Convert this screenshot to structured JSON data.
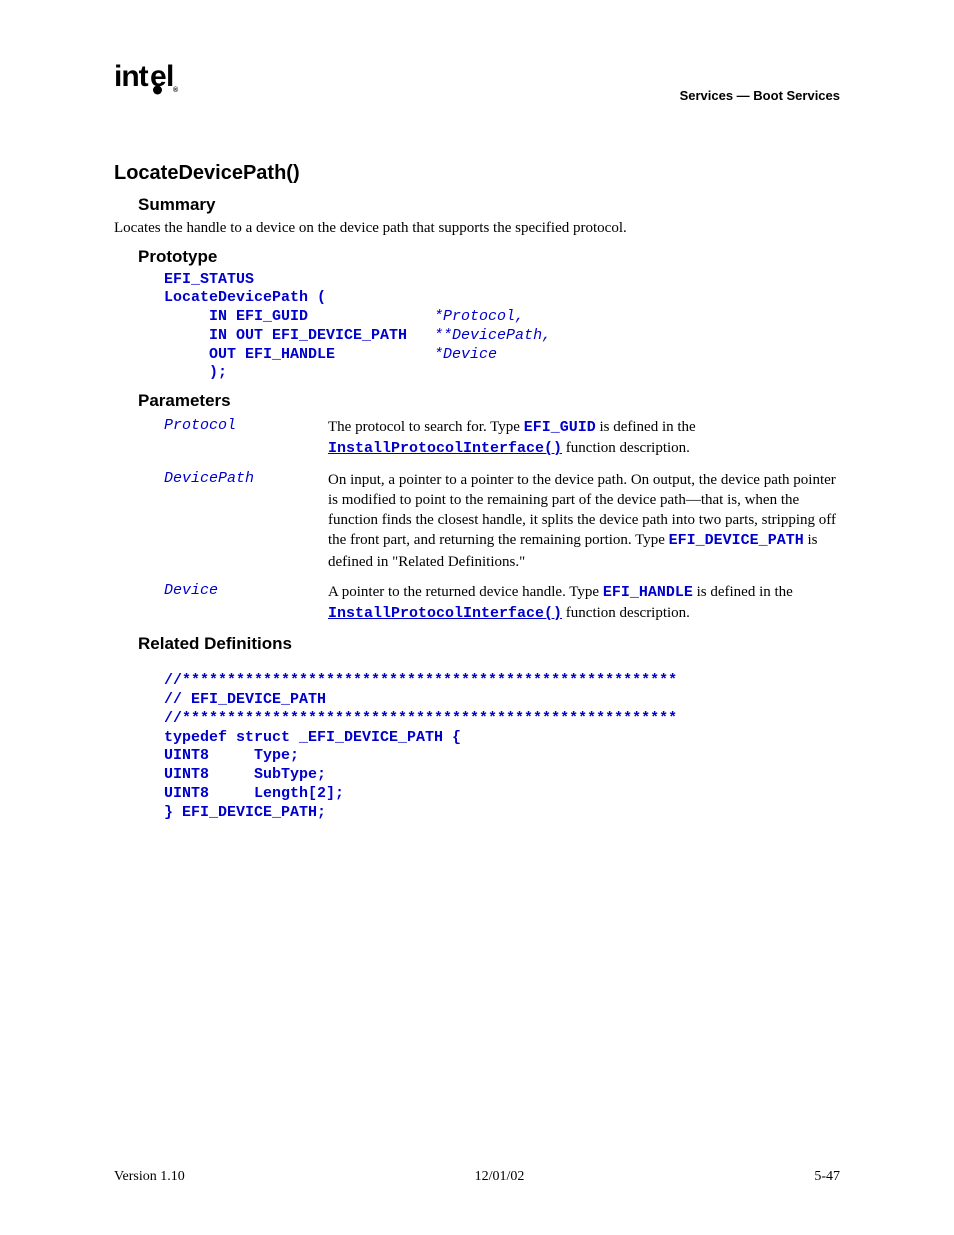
{
  "header": {
    "right": "Services — Boot Services",
    "logo_text": "intel"
  },
  "title": "LocateDevicePath()",
  "sections": {
    "summary": {
      "heading": "Summary",
      "text": "Locates the handle to a device on the device path that supports the specified protocol."
    },
    "prototype": {
      "heading": "Prototype",
      "code_l1": "EFI_STATUS",
      "code_l2": "LocateDevicePath (",
      "code_l3a": "     IN EFI_GUID              ",
      "code_l3b": "*Protocol,",
      "code_l4a": "     IN OUT EFI_DEVICE_PATH   ",
      "code_l4b": "**DevicePath,",
      "code_l5a": "     OUT EFI_HANDLE           ",
      "code_l5b": "*Device",
      "code_l6": "     );"
    },
    "parameters": {
      "heading": "Parameters",
      "rows": [
        {
          "name": "Protocol",
          "d1": "The protocol to search for.  Type ",
          "c1": "EFI_GUID",
          "d2": " is defined in the ",
          "c2": "InstallProtocolInterface()",
          "d3": " function description."
        },
        {
          "name": "DevicePath",
          "d1": "On input, a pointer to a pointer to the device path.  On output, the device path pointer is modified to point to the remaining part of the device path—that is, when the function finds the closest handle, it splits the device path into two parts, stripping off the front part, and returning the remaining portion.  Type ",
          "c1": "EFI_DEVICE_PATH",
          "d2": " is defined in \"Related Definitions.\""
        },
        {
          "name": "Device",
          "d1": "A pointer to the returned device handle.  Type ",
          "c1": "EFI_HANDLE",
          "d2": " is defined in the ",
          "c2": "InstallProtocolInterface()",
          "d3": " function description."
        }
      ]
    },
    "related": {
      "heading": "Related Definitions",
      "code": "//*******************************************************\n// EFI_DEVICE_PATH\n//*******************************************************\ntypedef struct _EFI_DEVICE_PATH {\nUINT8     Type;\nUINT8     SubType;\nUINT8     Length[2];\n} EFI_DEVICE_PATH;"
    }
  },
  "footer": {
    "left": "Version 1.10",
    "center": "12/01/02",
    "right": "5-47"
  }
}
